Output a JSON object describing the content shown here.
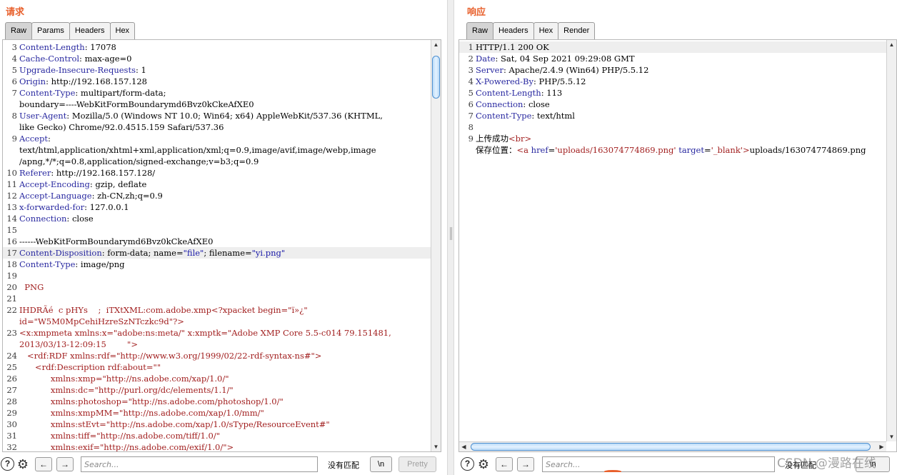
{
  "request": {
    "title": "请求",
    "tabs": [
      "Raw",
      "Params",
      "Headers",
      "Hex"
    ],
    "active_tab": "Raw",
    "lines": [
      {
        "n": "3",
        "segs": [
          {
            "t": "Content-Length",
            "c": "h"
          },
          {
            "t": ": 17078",
            "c": "v"
          }
        ]
      },
      {
        "n": "4",
        "segs": [
          {
            "t": "Cache-Control",
            "c": "h"
          },
          {
            "t": ": max-age=0",
            "c": "v"
          }
        ]
      },
      {
        "n": "5",
        "segs": [
          {
            "t": "Upgrade-Insecure-Requests",
            "c": "h"
          },
          {
            "t": ": 1",
            "c": "v"
          }
        ]
      },
      {
        "n": "6",
        "segs": [
          {
            "t": "Origin",
            "c": "h"
          },
          {
            "t": ": http://192.168.157.128",
            "c": "v"
          }
        ]
      },
      {
        "n": "7",
        "segs": [
          {
            "t": "Content-Type",
            "c": "h"
          },
          {
            "t": ": multipart/form-data;",
            "c": "v"
          }
        ]
      },
      {
        "n": "",
        "segs": [
          {
            "t": "boundary=----WebKitFormBoundarymd6Bvz0kCkeAfXE0",
            "c": "v"
          }
        ]
      },
      {
        "n": "8",
        "segs": [
          {
            "t": "User-Agent",
            "c": "h"
          },
          {
            "t": ": Mozilla/5.0 (Windows NT 10.0; Win64; x64) AppleWebKit/537.36 (KHTML,",
            "c": "v"
          }
        ]
      },
      {
        "n": "",
        "segs": [
          {
            "t": "like Gecko) Chrome/92.0.4515.159 Safari/537.36",
            "c": "v"
          }
        ]
      },
      {
        "n": "9",
        "segs": [
          {
            "t": "Accept",
            "c": "h"
          },
          {
            "t": ":",
            "c": "v"
          }
        ]
      },
      {
        "n": "",
        "segs": [
          {
            "t": "text/html,application/xhtml+xml,application/xml;q=0.9,image/avif,image/webp,image",
            "c": "v"
          }
        ]
      },
      {
        "n": "",
        "segs": [
          {
            "t": "/apng,*/*;q=0.8,application/signed-exchange;v=b3;q=0.9",
            "c": "v"
          }
        ]
      },
      {
        "n": "10",
        "segs": [
          {
            "t": "Referer",
            "c": "h"
          },
          {
            "t": ": http://192.168.157.128/",
            "c": "v"
          }
        ]
      },
      {
        "n": "11",
        "segs": [
          {
            "t": "Accept-Encoding",
            "c": "h"
          },
          {
            "t": ": gzip, deflate",
            "c": "v"
          }
        ]
      },
      {
        "n": "12",
        "segs": [
          {
            "t": "Accept-Language",
            "c": "h"
          },
          {
            "t": ": zh-CN,zh;q=0.9",
            "c": "v"
          }
        ]
      },
      {
        "n": "13",
        "segs": [
          {
            "t": "x-forwarded-for",
            "c": "h"
          },
          {
            "t": ": 127.0.0.1",
            "c": "v"
          }
        ]
      },
      {
        "n": "14",
        "segs": [
          {
            "t": "Connection",
            "c": "h"
          },
          {
            "t": ": close",
            "c": "v"
          }
        ]
      },
      {
        "n": "15",
        "segs": []
      },
      {
        "n": "16",
        "segs": [
          {
            "t": "------WebKitFormBoundarymd6Bvz0kCkeAfXE0",
            "c": "v"
          }
        ]
      },
      {
        "n": "17",
        "hl": true,
        "segs": [
          {
            "t": "Content-Disposition",
            "c": "h"
          },
          {
            "t": ": form-data; name=",
            "c": "v"
          },
          {
            "t": "\"file\"",
            "c": "b"
          },
          {
            "t": "; filename=",
            "c": "v"
          },
          {
            "t": "\"yi.png\"",
            "c": "b"
          }
        ]
      },
      {
        "n": "18",
        "segs": [
          {
            "t": "Content-Type",
            "c": "h"
          },
          {
            "t": ": image/png",
            "c": "v"
          }
        ]
      },
      {
        "n": "19",
        "segs": []
      },
      {
        "n": "20",
        "segs": [
          {
            "t": "  PNG",
            "c": "r"
          }
        ]
      },
      {
        "n": "21",
        "segs": []
      },
      {
        "n": "22",
        "segs": [
          {
            "t": "IHDRÃé  c pHYs    ;  iTXtXML:com.adobe.xmp<?xpacket begin=\"ï»¿\"",
            "c": "r"
          }
        ]
      },
      {
        "n": "",
        "segs": [
          {
            "t": "id=\"W5M0MpCehiHzreSzNTczkc9d\"?>",
            "c": "r"
          }
        ]
      },
      {
        "n": "23",
        "segs": [
          {
            "t": "<x:xmpmeta xmlns:x=\"adobe:ns:meta/\" x:xmptk=\"Adobe XMP Core 5.5-c014 79.151481,",
            "c": "r"
          }
        ]
      },
      {
        "n": "",
        "segs": [
          {
            "t": "2013/03/13-12:09:15        \">",
            "c": "r"
          }
        ]
      },
      {
        "n": "24",
        "segs": [
          {
            "t": "   <rdf:RDF xmlns:rdf=\"http://www.w3.org/1999/02/22-rdf-syntax-ns#\">",
            "c": "r"
          }
        ]
      },
      {
        "n": "25",
        "segs": [
          {
            "t": "      <rdf:Description rdf:about=\"\"",
            "c": "r"
          }
        ]
      },
      {
        "n": "26",
        "segs": [
          {
            "t": "            xmlns:xmp=\"http://ns.adobe.com/xap/1.0/\"",
            "c": "r"
          }
        ]
      },
      {
        "n": "27",
        "segs": [
          {
            "t": "            xmlns:dc=\"http://purl.org/dc/elements/1.1/\"",
            "c": "r"
          }
        ]
      },
      {
        "n": "28",
        "segs": [
          {
            "t": "            xmlns:photoshop=\"http://ns.adobe.com/photoshop/1.0/\"",
            "c": "r"
          }
        ]
      },
      {
        "n": "29",
        "segs": [
          {
            "t": "            xmlns:xmpMM=\"http://ns.adobe.com/xap/1.0/mm/\"",
            "c": "r"
          }
        ]
      },
      {
        "n": "30",
        "segs": [
          {
            "t": "            xmlns:stEvt=\"http://ns.adobe.com/xap/1.0/sType/ResourceEvent#\"",
            "c": "r"
          }
        ]
      },
      {
        "n": "31",
        "segs": [
          {
            "t": "            xmlns:tiff=\"http://ns.adobe.com/tiff/1.0/\"",
            "c": "r"
          }
        ]
      },
      {
        "n": "32",
        "segs": [
          {
            "t": "            xmlns:exif=\"http://ns.adobe.com/exif/1.0/\">",
            "c": "r"
          }
        ]
      }
    ],
    "bottom": {
      "help": "?",
      "prev": "←",
      "next": "→",
      "search_placeholder": "Search...",
      "match_label": "没有匹配",
      "newline_btn": "\\n",
      "pretty_btn": "Pretty"
    }
  },
  "response": {
    "title": "响应",
    "tabs": [
      "Raw",
      "Headers",
      "Hex",
      "Render"
    ],
    "active_tab": "Raw",
    "lines": [
      {
        "n": "1",
        "hl": true,
        "segs": [
          {
            "t": "HTTP/1.1 200 OK",
            "c": "v"
          }
        ]
      },
      {
        "n": "2",
        "segs": [
          {
            "t": "Date",
            "c": "h"
          },
          {
            "t": ": Sat, 04 Sep 2021 09:29:08 GMT",
            "c": "v"
          }
        ]
      },
      {
        "n": "3",
        "segs": [
          {
            "t": "Server",
            "c": "h"
          },
          {
            "t": ": Apache/2.4.9 (Win64) PHP/5.5.12",
            "c": "v"
          }
        ]
      },
      {
        "n": "4",
        "segs": [
          {
            "t": "X-Powered-By",
            "c": "h"
          },
          {
            "t": ": PHP/5.5.12",
            "c": "v"
          }
        ]
      },
      {
        "n": "5",
        "segs": [
          {
            "t": "Content-Length",
            "c": "h"
          },
          {
            "t": ": 113",
            "c": "v"
          }
        ]
      },
      {
        "n": "6",
        "segs": [
          {
            "t": "Connection",
            "c": "h"
          },
          {
            "t": ": close",
            "c": "v"
          }
        ]
      },
      {
        "n": "7",
        "segs": [
          {
            "t": "Content-Type",
            "c": "h"
          },
          {
            "t": ": text/html",
            "c": "v"
          }
        ]
      },
      {
        "n": "8",
        "segs": []
      },
      {
        "n": "9",
        "segs": [
          {
            "t": "上传成功",
            "c": "v"
          },
          {
            "t": "<br>",
            "c": "r"
          }
        ]
      },
      {
        "n": "",
        "segs": [
          {
            "t": "保存位置：",
            "c": "v"
          },
          {
            "t": "<a ",
            "c": "r"
          },
          {
            "t": "href",
            "c": "h"
          },
          {
            "t": "=",
            "c": "v"
          },
          {
            "t": "'uploads/163074774869.png'",
            "c": "s"
          },
          {
            "t": " target",
            "c": "h"
          },
          {
            "t": "=",
            "c": "v"
          },
          {
            "t": "'_blank'",
            "c": "s"
          },
          {
            "t": ">",
            "c": "r"
          },
          {
            "t": "uploads/163074774869.png",
            "c": "v"
          }
        ]
      }
    ],
    "bottom": {
      "help": "?",
      "prev": "←",
      "next": "→",
      "search_placeholder": "Search...",
      "match_label": "没有匹配",
      "newline_btn": "\\n"
    }
  },
  "watermark": "CSDN @漫路在线",
  "icons": [
    "help-icon",
    "gear-icon",
    "arrow-left-icon",
    "arrow-right-icon",
    "scroll-up-icon",
    "scroll-down-icon",
    "scroll-left-icon",
    "scroll-right-icon"
  ]
}
